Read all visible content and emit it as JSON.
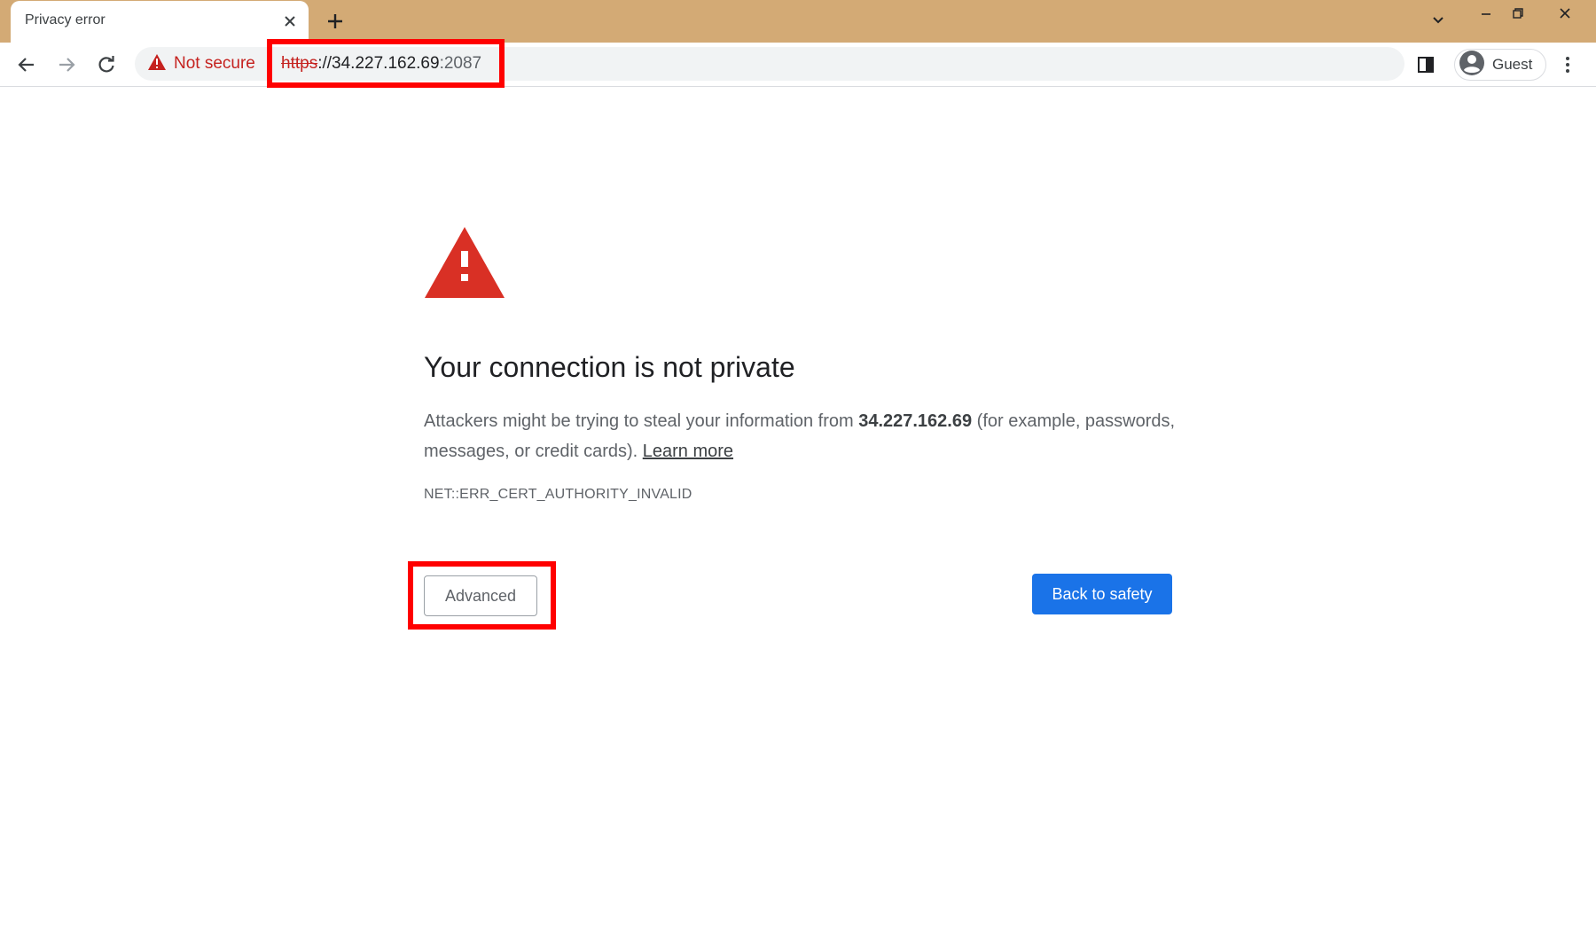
{
  "browser": {
    "tab": {
      "title": "Privacy error",
      "close_icon": "close-icon"
    },
    "new_tab_icon": "plus-icon",
    "window_controls": [
      "chevron-down-icon",
      "minimize-icon",
      "restore-icon",
      "close-icon"
    ],
    "toolbar": {
      "back_icon": "arrow-left-icon",
      "forward_icon": "arrow-right-icon",
      "reload_icon": "reload-icon",
      "security": {
        "icon": "warning-triangle-icon",
        "label": "Not secure"
      },
      "url": {
        "scheme": "https",
        "separator": "://",
        "host": "34.227.162.69",
        "port": ":2087"
      },
      "side_panel_icon": "side-panel-icon",
      "profile": {
        "icon": "account-circle-icon",
        "label": "Guest"
      },
      "menu_icon": "more-vert-icon"
    }
  },
  "interstitial": {
    "icon": "warning-triangle-icon",
    "heading": "Your connection is not private",
    "body_prefix": "Attackers might be trying to steal your information from ",
    "host": "34.227.162.69",
    "body_suffix": " (for example, passwords, messages, or credit cards). ",
    "learn_more": "Learn more",
    "error_code": "NET::ERR_CERT_AUTHORITY_INVALID",
    "advanced_button": "Advanced",
    "back_button": "Back to safety"
  },
  "colors": {
    "tabstrip": "#d3aa75",
    "warning_red": "#d93025",
    "not_secure_red": "#c5221f",
    "primary_blue": "#1a73e8",
    "highlight_red": "#ff0000"
  }
}
